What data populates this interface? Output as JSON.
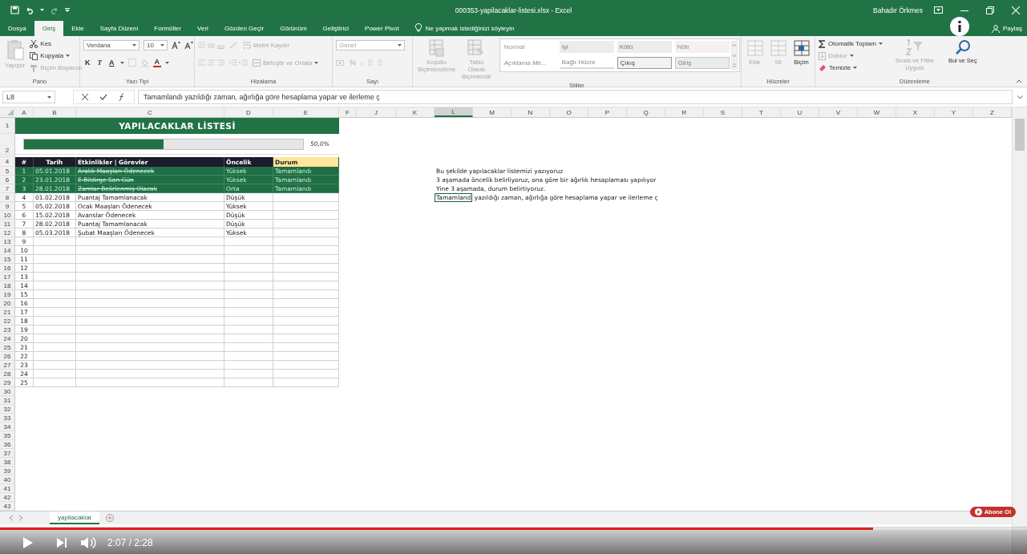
{
  "window": {
    "title": "000353-yapilacaklar-listesi.xlsx  -  Excel",
    "user": "Bahadır Örkmes"
  },
  "ribbon_tabs": [
    {
      "label": "Dosya",
      "selected": false
    },
    {
      "label": "Giriş",
      "selected": true
    },
    {
      "label": "Ekle",
      "selected": false
    },
    {
      "label": "Sayfa Düzeni",
      "selected": false
    },
    {
      "label": "Formüller",
      "selected": false
    },
    {
      "label": "Veri",
      "selected": false
    },
    {
      "label": "Gözden Geçir",
      "selected": false
    },
    {
      "label": "Görünüm",
      "selected": false
    },
    {
      "label": "Geliştirici",
      "selected": false
    },
    {
      "label": "Power Pivot",
      "selected": false
    }
  ],
  "tell_me": "Ne yapmak istediğinizi söyleyin",
  "share": "Paylaş",
  "ribbon": {
    "clipboard": {
      "title": "Pano",
      "paste": {
        "label": "Yapıştır",
        "disabled": true
      },
      "cut": {
        "label": "Kes",
        "disabled": false
      },
      "copy": {
        "label": "Kopyala",
        "disabled": false
      },
      "format_painter": {
        "label": "Biçim Boyacısı",
        "disabled": true
      }
    },
    "font": {
      "title": "Yazı Tipi",
      "family": "Verdana",
      "size": "10",
      "bold": "K",
      "italic": "T",
      "underline": "A",
      "font_color": "A"
    },
    "alignment": {
      "title": "Hizalama",
      "wrap_text": {
        "label": "Metni Kaydır",
        "disabled": true
      },
      "merge": {
        "label": "Birleştir ve Ortala",
        "disabled": true
      }
    },
    "number": {
      "title": "Sayı",
      "format": "Genel",
      "percent": "%"
    },
    "styles": {
      "title": "Stiller",
      "conditional": {
        "label": "Koşullu Biçimlendirme",
        "disabled": true
      },
      "format_table": {
        "label": "Tablo Olarak Biçimlendir",
        "disabled": true
      },
      "cell_styles": [
        {
          "label": "Normal",
          "kind": "normal"
        },
        {
          "label": "İyi",
          "kind": "good"
        },
        {
          "label": "Kötü",
          "kind": "bad"
        },
        {
          "label": "Nötr",
          "kind": "neutral"
        },
        {
          "label": "Açıklama Me...",
          "kind": "note"
        },
        {
          "label": "Bağlı Hücre",
          "kind": "linked"
        },
        {
          "label": "Çıkış",
          "kind": "output"
        },
        {
          "label": "Giriş",
          "kind": "input"
        }
      ]
    },
    "cells": {
      "title": "Hücreler",
      "items": [
        {
          "label": "Ekle",
          "disabled": true
        },
        {
          "label": "Sil",
          "disabled": true
        },
        {
          "label": "Biçim",
          "disabled": false
        }
      ]
    },
    "editing": {
      "title": "Düzenleme",
      "autosum": {
        "label": "Otomatik Toplam",
        "disabled": false
      },
      "fill": {
        "label": "Doldur",
        "disabled": true
      },
      "clear": {
        "label": "Temizle",
        "disabled": false
      },
      "sort": {
        "label": "Sırala ve Filtre Uygula",
        "disabled": true
      },
      "find": {
        "label": "Bul ve Seç",
        "disabled": false
      }
    }
  },
  "formula_bar": {
    "name_box": "L8",
    "formula": "Tamamlandı yazıldığı zaman, ağırlığa göre hesaplama yapar ve ilerleme ç"
  },
  "columns": [
    {
      "label": "A",
      "selected": false
    },
    {
      "label": "B",
      "selected": false
    },
    {
      "label": "C",
      "selected": false
    },
    {
      "label": "D",
      "selected": false
    },
    {
      "label": "E",
      "selected": false
    },
    {
      "label": "F",
      "selected": false
    },
    {
      "label": "J",
      "selected": false
    },
    {
      "label": "K",
      "selected": false
    },
    {
      "label": "L",
      "selected": true
    },
    {
      "label": "M",
      "selected": false
    },
    {
      "label": "N",
      "selected": false
    },
    {
      "label": "O",
      "selected": false
    },
    {
      "label": "P",
      "selected": false
    },
    {
      "label": "Q",
      "selected": false
    },
    {
      "label": "R",
      "selected": false
    },
    {
      "label": "S",
      "selected": false
    },
    {
      "label": "T",
      "selected": false
    },
    {
      "label": "U",
      "selected": false
    },
    {
      "label": "V",
      "selected": false
    },
    {
      "label": "W",
      "selected": false
    },
    {
      "label": "X",
      "selected": false
    },
    {
      "label": "Y",
      "selected": false
    },
    {
      "label": "Z",
      "selected": false
    }
  ],
  "sheet": {
    "title": {
      "row": "1",
      "text": "YAPILACAKLAR LİSTESİ"
    },
    "progress": {
      "row": "2",
      "level": 0.5,
      "reading": "50,0%"
    },
    "header": {
      "row": "4",
      "cells": [
        "#",
        "Tarih",
        "Etkinlikler | Görevler",
        "Öncelik",
        "Durum"
      ]
    },
    "rows": [
      {
        "row": "5",
        "no": "1",
        "date": "05.01.2018",
        "task": "Aralık Maaşları Ödenecek",
        "priority": "Yüksek",
        "status": "Tamamlandı",
        "done": true,
        "note": {
          "text": "Bu şekilde yapılacaklar listemizi yazıyoruz",
          "selected": false
        }
      },
      {
        "row": "6",
        "no": "2",
        "date": "23.01.2018",
        "task": "E-Bildirge Son Gün",
        "priority": "Yüksek",
        "status": "Tamamlandı",
        "done": true,
        "note": {
          "text": "3 aşamada öncelik belirliyoruz, ona göre bir ağırlık hesaplaması yapılıyor",
          "selected": false
        }
      },
      {
        "row": "7",
        "no": "3",
        "date": "28.01.2018",
        "task": "Zamlar Belirlenmiş Olacak",
        "priority": "Orta",
        "status": "Tamamlandı",
        "done": true,
        "note": {
          "text": "Yine 3 aşamada, durum belirtiyoruz.",
          "selected": false
        }
      },
      {
        "row": "8",
        "no": "4",
        "date": "01.02.2018",
        "task": "Puantaj Tamamlanacak",
        "priority": "Düşük",
        "done": false,
        "note": {
          "text": "Tamamlandı yazıldığı zaman, ağırlığa göre hesaplama yapar ve ilerleme ç",
          "selected": true
        }
      },
      {
        "row": "9",
        "no": "5",
        "date": "05.02.2018",
        "task": "Ocak Maaşları Ödenecek",
        "priority": "Yüksek",
        "done": false
      },
      {
        "row": "10",
        "no": "6",
        "date": "15.02.2018",
        "task": "Avanslar Ödenecek",
        "priority": "Düşük",
        "done": false
      },
      {
        "row": "11",
        "no": "7",
        "date": "28.02.2018",
        "task": "Puantaj Tamamlanacak",
        "priority": "Düşük",
        "done": false
      },
      {
        "row": "12",
        "no": "8",
        "date": "05.03.2018",
        "task": "Şubat Maaşları Ödenecek",
        "priority": "Yüksek",
        "done": false
      },
      {
        "row": "13",
        "no": "9"
      },
      {
        "row": "14",
        "no": "10"
      },
      {
        "row": "15",
        "no": "11"
      },
      {
        "row": "16",
        "no": "12"
      },
      {
        "row": "17",
        "no": "13"
      },
      {
        "row": "18",
        "no": "14"
      },
      {
        "row": "19",
        "no": "15"
      },
      {
        "row": "20",
        "no": "16"
      },
      {
        "row": "21",
        "no": "17"
      },
      {
        "row": "22",
        "no": "18"
      },
      {
        "row": "23",
        "no": "19"
      },
      {
        "row": "24",
        "no": "20"
      },
      {
        "row": "25",
        "no": "21"
      },
      {
        "row": "26",
        "no": "22"
      },
      {
        "row": "27",
        "no": "23"
      },
      {
        "row": "28",
        "no": "24"
      },
      {
        "row": "29",
        "no": "25"
      }
    ],
    "blank_rows": [
      "30",
      "31",
      "32",
      "33",
      "34",
      "35",
      "36",
      "37",
      "38",
      "39",
      "40",
      "41",
      "42",
      "43"
    ],
    "sheet_tab": "yapilacaklar"
  },
  "video": {
    "level": 0.85,
    "time": "2:07 / 2:28",
    "subscribe": "Abone Ol"
  }
}
